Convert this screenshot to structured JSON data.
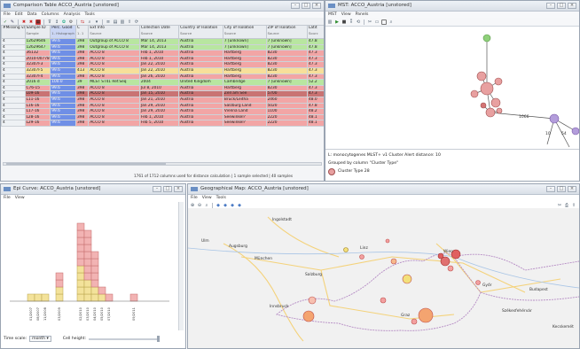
{
  "table_window": {
    "title": "Comparison Table ACCO_Austria [unstored]",
    "menu": [
      "File",
      "Edit",
      "Data",
      "Columns",
      "Analysis",
      "Tools"
    ],
    "columns": [
      {
        "name": "#Missing values",
        "sub": ""
      },
      {
        "name": "Sample ID",
        "sub": "Sample"
      },
      {
        "name": "Perc. Good",
        "sub": "1. Histograph"
      },
      {
        "name": "C",
        "sub": "1. 1"
      },
      {
        "name": "Ext Info",
        "sub": "Source"
      },
      {
        "name": "Collection Date",
        "sub": "Source"
      },
      {
        "name": "Country of Isolation",
        "sub": "Source"
      },
      {
        "name": "City of Isolation",
        "sub": "Source"
      },
      {
        "name": "ZIP of Isolation",
        "sub": "Source"
      },
      {
        "name": "Latit",
        "sub": "Sourc"
      }
    ],
    "rows": [
      {
        "color": "#b8e6a0",
        "cells": [
          "4",
          "12629646",
          "99.6",
          "398",
          "Outgroup of ACCO 8",
          "Mar 14, 2013",
          "Austria",
          "7 [unknown]",
          "7 [unknown]",
          "47.8"
        ]
      },
      {
        "color": "#b8e6a0",
        "cells": [
          "4",
          "12629647",
          "99.6",
          "398",
          "Outgroup of ACCO 8",
          "Mar 14, 2013",
          "Austria",
          "7 [unknown]",
          "7 [unknown]",
          "47.8"
        ]
      },
      {
        "color": "#f2a5a5",
        "cells": [
          "4",
          "36132",
          "99.6",
          "398",
          "ACCO 8",
          "Feb 1, 2010",
          "Austria",
          "Hartberg",
          "8230",
          "47.3"
        ]
      },
      {
        "color": "#f2a5a5",
        "cells": [
          "4",
          "2010-00778",
          "99.6",
          "398",
          "ACCO 8",
          "Feb 1, 2010",
          "Austria",
          "Hartberg",
          "8230",
          "47.3"
        ]
      },
      {
        "color": "#f2a5a5",
        "cells": [
          "4",
          "32307F3",
          "99.6",
          "398",
          "ACCO 8",
          "Jan 22, 2010",
          "Austria",
          "Hartberg",
          "8230",
          "47.3"
        ]
      },
      {
        "color": "#f7df9a",
        "cells": [
          "4",
          "32307F5",
          "99.6",
          "413",
          "ACCO 8",
          "Jan 22, 2010",
          "Austria",
          "Hartberg",
          "8230",
          "47.3"
        ]
      },
      {
        "color": "#f2a5a5",
        "cells": [
          "4",
          "32307F4",
          "99.6",
          "398",
          "ACCO 8",
          "Jan 26, 2010",
          "Austria",
          "Hartberg",
          "8230",
          "47.3"
        ]
      },
      {
        "color": "#b8e6a0",
        "cells": [
          "4",
          "2016 d",
          "100.0",
          "39",
          "MLST ST41 Ref.Seq",
          "2004",
          "United Kingdom",
          "Cambridge",
          "7 [unknown]",
          "52.2"
        ]
      },
      {
        "color": "#f2a5a5",
        "cells": [
          "4",
          "C76-15",
          "99.6",
          "398",
          "ACCO 8",
          "Jul 8, 2010",
          "Austria",
          "Hartberg",
          "8230",
          "47.3"
        ]
      },
      {
        "color": "#c97373",
        "cells": [
          "4",
          "L09-16",
          "99.6",
          "398",
          "ACCO 8",
          "Jan 15, 2010",
          "Austria",
          "Zell am See",
          "5700",
          "47.3"
        ]
      },
      {
        "color": "#f2a5a5",
        "cells": [
          "4",
          "L11-16",
          "99.6",
          "398",
          "ACCO 8",
          "Jan 21, 2010",
          "Austria",
          "Bruck/Leitha",
          "2460",
          "48.0"
        ]
      },
      {
        "color": "#f2a5a5",
        "cells": [
          "4",
          "L16-16",
          "99.6",
          "398",
          "ACCO 8",
          "Jan 29, 2010",
          "Austria",
          "Salzburg Land",
          "5020",
          "47.8"
        ]
      },
      {
        "color": "#f2a5a5",
        "cells": [
          "4",
          "L17-16",
          "99.6",
          "398",
          "ACCO 8",
          "Jan 29, 2010",
          "Austria",
          "Vienna Land",
          "1100",
          "48.2"
        ]
      },
      {
        "color": "#f2a5a5",
        "cells": [
          "4",
          "L28-16",
          "99.6",
          "398",
          "ACCO 8",
          "Feb 1, 2010",
          "Austria",
          "Seewinkel?",
          "2220",
          "48.1"
        ]
      },
      {
        "color": "#f2a5a5",
        "cells": [
          "4",
          "L29-16",
          "99.6",
          "398",
          "ACCO 8",
          "Feb 5, 2010",
          "Austria",
          "Seewinkel?",
          "2220",
          "48.1"
        ]
      }
    ],
    "status": "1761 of 1712 columns used for distance calculation  |  1 sample selected  |  40 samples"
  },
  "mst_window": {
    "title": "MST: ACCO_Austria [unstored]",
    "menu": [
      "MST",
      "View",
      "Panels"
    ],
    "edge_labels": [
      "1066",
      "54",
      "10"
    ],
    "info_line": "L: monocytogenes MLST+ v1 Cluster Alert distance: 10",
    "grouped_by": "Grouped by column \"Cluster Type\"",
    "legend_item": "Cluster Type 28",
    "legend_color": "#e8a0a0"
  },
  "epi_window": {
    "title": "Epi Curve: ACCO_Austria [unstored]",
    "menu": [
      "File",
      "View"
    ],
    "time_scale_label": "Time scale:",
    "time_scale_value": "month",
    "cell_height_label": "Cell height:",
    "chart_data": {
      "type": "bar",
      "categories": [
        "01/2007",
        "08/2007",
        "11/2008",
        "03/2009",
        "02/2010",
        "03/2010",
        "04/2010",
        "05/2010",
        "07/2010",
        "09/2011"
      ],
      "yellow_values": [
        1,
        1,
        1,
        2,
        5,
        3,
        2,
        1,
        0,
        0
      ],
      "red_values": [
        0,
        0,
        0,
        2,
        6,
        7,
        5,
        1,
        1,
        1
      ]
    }
  },
  "map_window": {
    "title": "Geographical Map: ACCO_Austria [unstored]",
    "menu": [
      "File",
      "View",
      "Tools"
    ],
    "cities": [
      "Ingolstadt",
      "Ulm",
      "Augsburg",
      "München",
      "Linz",
      "Wien",
      "Salzburg",
      "Innsbruck",
      "Graz",
      "Győr",
      "Budapest",
      "Székesfehérvár",
      "Kecskemét"
    ]
  }
}
